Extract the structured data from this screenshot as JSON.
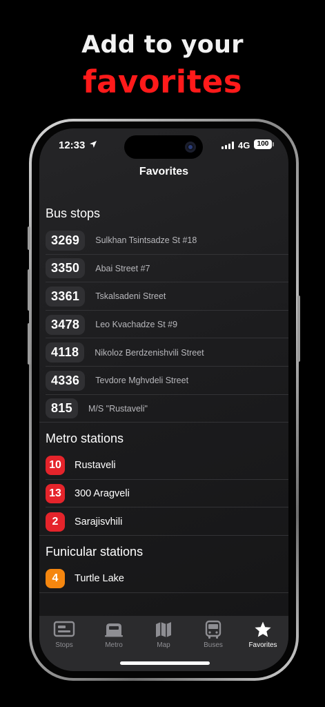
{
  "promo": {
    "line1": "Add to your",
    "line2": "favorites"
  },
  "status_bar": {
    "time": "12:33",
    "network": "4G",
    "battery": "100"
  },
  "nav": {
    "title": "Favorites"
  },
  "sections": {
    "bus": {
      "title": "Bus stops",
      "items": [
        {
          "code": "3269",
          "name": "Sulkhan Tsintsadze St #18"
        },
        {
          "code": "3350",
          "name": "Abai Street #7"
        },
        {
          "code": "3361",
          "name": "Tskalsadeni Street"
        },
        {
          "code": "3478",
          "name": "Leo Kvachadze St #9"
        },
        {
          "code": "4118",
          "name": "Nikoloz Berdzenishvili Street"
        },
        {
          "code": "4336",
          "name": "Tevdore Mghvdeli Street"
        },
        {
          "code": "815",
          "name": "M/S \"Rustaveli\""
        }
      ]
    },
    "metro": {
      "title": "Metro stations",
      "items": [
        {
          "code": "10",
          "name": "Rustaveli",
          "color": "#e5242b"
        },
        {
          "code": "13",
          "name": "300 Aragveli",
          "color": "#e5242b"
        },
        {
          "code": "2",
          "name": "Sarajisvhili",
          "color": "#e5242b"
        }
      ]
    },
    "funicular": {
      "title": "Funicular stations",
      "items": [
        {
          "code": "4",
          "name": "Turtle Lake",
          "color": "#f5860f"
        }
      ]
    }
  },
  "tabbar": {
    "tabs": [
      {
        "label": "Stops",
        "icon": "stop-sign-icon",
        "active": false
      },
      {
        "label": "Metro",
        "icon": "metro-train-icon",
        "active": false
      },
      {
        "label": "Map",
        "icon": "map-icon",
        "active": false
      },
      {
        "label": "Buses",
        "icon": "bus-icon",
        "active": false
      },
      {
        "label": "Favorites",
        "icon": "star-icon",
        "active": true
      }
    ]
  },
  "colors": {
    "accent": "#ff1a1a",
    "metro_red": "#e5242b",
    "funicular_orange": "#f5860f",
    "background": "#1c1c1e"
  }
}
